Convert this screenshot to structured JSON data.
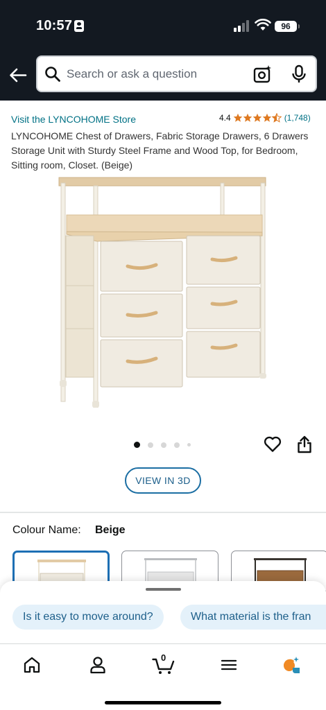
{
  "status_bar": {
    "time": "10:57",
    "battery": "96"
  },
  "search": {
    "placeholder": "Search or ask a question"
  },
  "product": {
    "store_link": "Visit the LYNCOHOME Store",
    "rating": "4.4",
    "rating_count": "(1,748)",
    "stars": 4.4,
    "title": "LYNCOHOME Chest of Drawers, Fabric Storage Drawers, 6 Drawers Storage Unit with Sturdy Steel Frame and Wood Top, for Bedroom, Sitting room, Closet. (Beige)",
    "image_count": 5,
    "active_image": 1
  },
  "actions": {
    "view_3d": "VIEW IN 3D"
  },
  "colour": {
    "label": "Colour Name:",
    "value": "Beige"
  },
  "suggestions": [
    "Is it easy to move around?",
    "What material is the fran"
  ],
  "cart": {
    "count": "0"
  },
  "colors": {
    "header_bg": "#131921",
    "link": "#007185",
    "star": "#de7921",
    "accent": "#1d6fb4"
  }
}
